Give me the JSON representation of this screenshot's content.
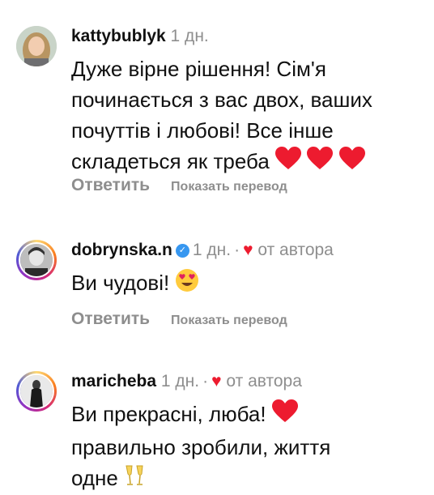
{
  "comments": [
    {
      "username": "kattybublyk",
      "time": "1 дн.",
      "lines": [
        "Дуже вірне рішення! Сім'я",
        "починається з вас двох, ваших",
        "почуттів і любові! Все інше",
        "складеться як треба"
      ],
      "emoji": [
        "heart",
        "heart",
        "heart"
      ],
      "reply": "Ответить",
      "translate": "Показать перевод"
    },
    {
      "username": "dobrynska.n",
      "verified": true,
      "time": "1 дн.",
      "liked_by_author": "от автора",
      "lines": [
        "Ви чудові!"
      ],
      "emoji": [
        "heart-eyes"
      ],
      "reply": "Ответить",
      "translate": "Показать перевод"
    },
    {
      "username": "maricheba",
      "time": "1 дн.",
      "liked_by_author": "от автора",
      "lines": [
        "Ви прекрасні, люба!",
        "правильно зробили, життя",
        "одне"
      ],
      "emoji": [
        "heart",
        "champagne"
      ]
    }
  ],
  "colors": {
    "muted": "#8e8e8e",
    "heart": "#ed1b2f",
    "verified": "#3797f0"
  }
}
